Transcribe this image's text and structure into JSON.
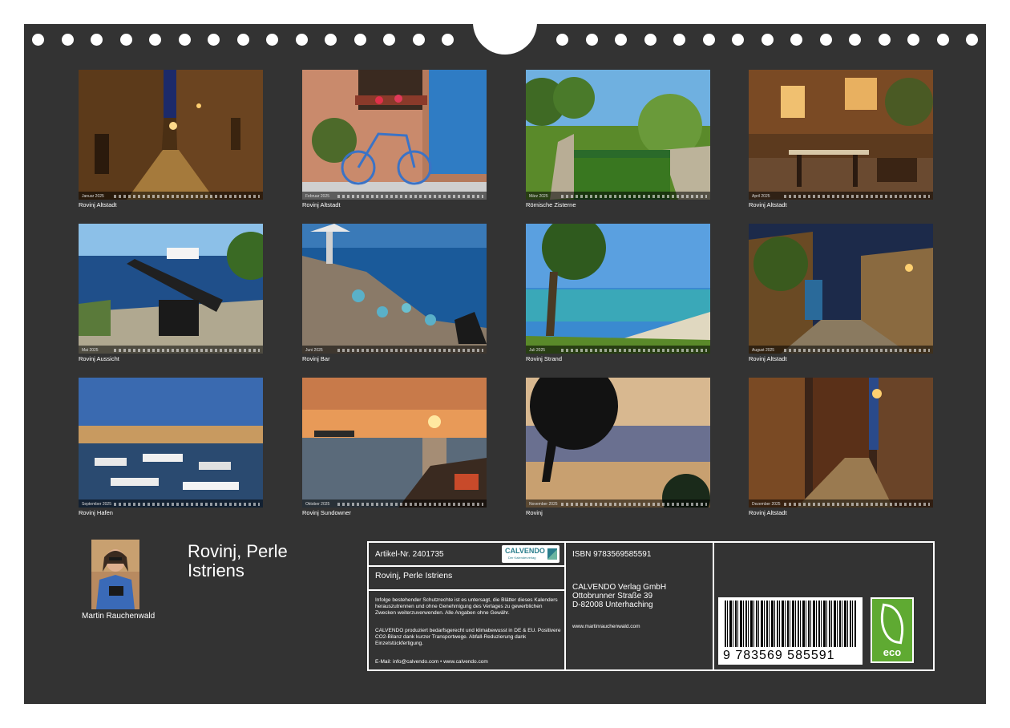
{
  "calendar": {
    "photos": [
      {
        "month": "Januar 2025",
        "caption": "Rovinj Altstadt",
        "scene": "night-alley"
      },
      {
        "month": "Februar 2025",
        "caption": "Rovinj Altstadt",
        "scene": "bicycle-door"
      },
      {
        "month": "März 2025",
        "caption": "Römische Zisterne",
        "scene": "cistern"
      },
      {
        "month": "April 2025",
        "caption": "Rovinj Altstadt",
        "scene": "terrace"
      },
      {
        "month": "Mai 2025",
        "caption": "Rovinj Aussicht",
        "scene": "cannon"
      },
      {
        "month": "Juni 2025",
        "caption": "Rovinj Bar",
        "scene": "bar"
      },
      {
        "month": "Juli 2025",
        "caption": "Rovinj Strand",
        "scene": "beach"
      },
      {
        "month": "August 2025",
        "caption": "Rovinj Altstadt",
        "scene": "evening-street"
      },
      {
        "month": "September 2025",
        "caption": "Rovinj Hafen",
        "scene": "harbour"
      },
      {
        "month": "Oktober 2025",
        "caption": "Rovinj Sundowner",
        "scene": "sunset-sea"
      },
      {
        "month": "November 2025",
        "caption": "Rovinj",
        "scene": "tree-sunset"
      },
      {
        "month": "Dezember 2025",
        "caption": "Rovinj Altstadt",
        "scene": "narrow-street"
      }
    ],
    "author": "Martin Rauchenwald",
    "title_line1": "Rovinj, Perle",
    "title_line2": "Istriens"
  },
  "info": {
    "article_no": "Artikel-Nr. 2401735",
    "product_title": "Rovinj, Perle Istriens",
    "legal_text": "Infolge bestehender Schutzrechte ist es untersagt, die Blätter dieses Kalenders herauszutrennen und ohne Genehmigung des Verlages zu gewerblichen Zwecken weiterzuverwenden. Alle Angaben ohne Gewähr.",
    "eco_text": "CALVENDO produziert bedarfsgerecht und klimabewusst in DE & EU. Positivere CO2-Bilanz dank kurzer Transportwege. Abfall-Reduzierung dank Einzelstückfertigung.",
    "contact": "E-Mail: info@calvendo.com • www.calvendo.com",
    "isbn": "ISBN 9783569585591",
    "publisher_name": "CALVENDO Verlag GmbH",
    "publisher_street": "Ottobrunner Straße 39",
    "publisher_city": "D-82008 Unterhaching",
    "website": "www.martinrauchenwald.com",
    "barcode_digits": "9 783569 585591",
    "logo_word": "CALVENDO",
    "logo_sub": "Der Kalenderverlag",
    "eco_label": "eco"
  },
  "colors": {
    "board": "#333333",
    "eco_green": "#5faa32",
    "logo_teal": "#2a7e8c"
  }
}
